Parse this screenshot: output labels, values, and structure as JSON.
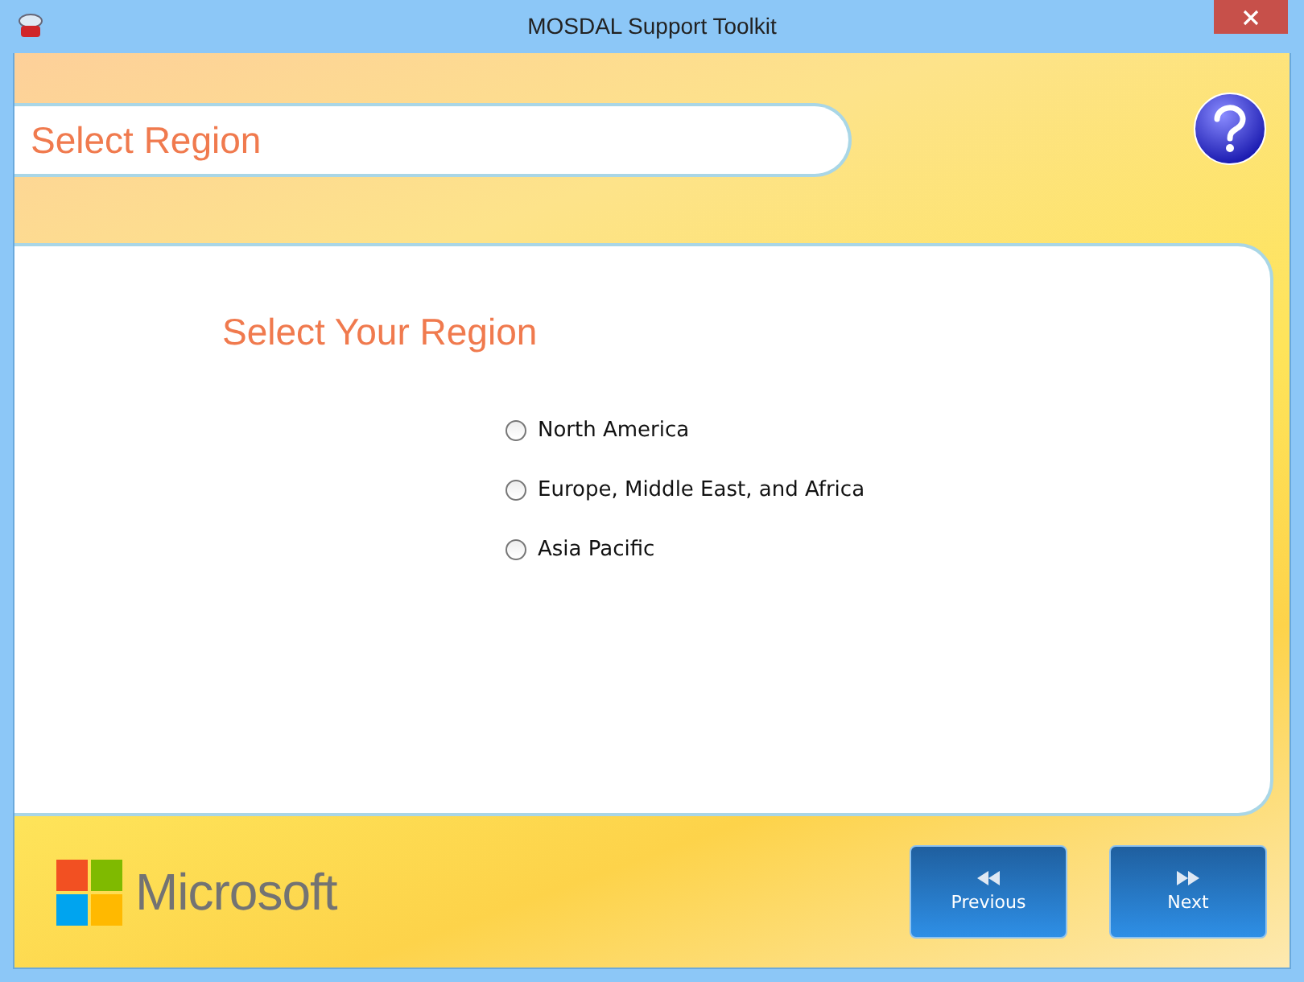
{
  "window": {
    "title": "MOSDAL Support Toolkit"
  },
  "header": {
    "title": "Select Region"
  },
  "panel": {
    "heading": "Select Your Region",
    "options": [
      {
        "label": "North America",
        "selected": false
      },
      {
        "label": "Europe, Middle East, and Africa",
        "selected": false
      },
      {
        "label": "Asia Pacific",
        "selected": false
      }
    ]
  },
  "footer": {
    "brand": "Microsoft",
    "buttons": [
      {
        "label": "Previous",
        "kind": "previous"
      },
      {
        "label": "Next",
        "kind": "next"
      }
    ]
  }
}
